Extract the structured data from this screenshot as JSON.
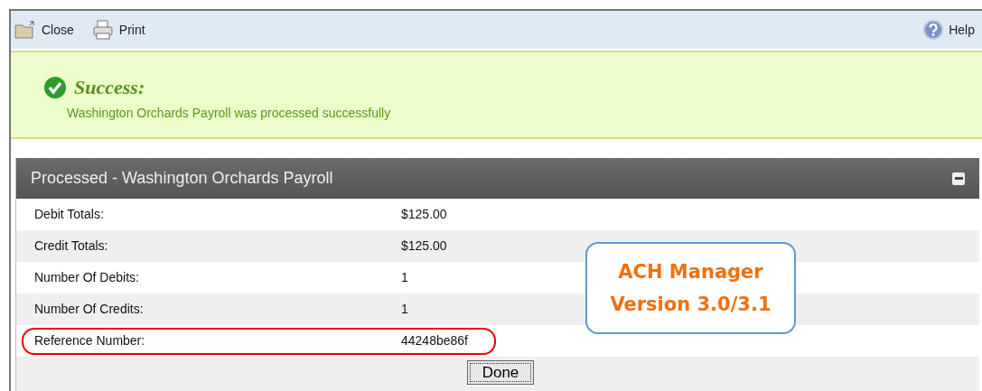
{
  "toolbar": {
    "left": [
      {
        "kind": "close",
        "label": "Close"
      },
      {
        "kind": "print",
        "label": "Print"
      }
    ],
    "right": {
      "kind": "help",
      "label": "Help"
    }
  },
  "message": {
    "title": "Success:",
    "text": "Washington Orchards Payroll was processed successfully"
  },
  "panel": {
    "title": "Processed - Washington Orchards Payroll",
    "rows": [
      {
        "label": "Debit Totals:",
        "value": "$125.00",
        "highlighted": false
      },
      {
        "label": "Credit Totals:",
        "value": "$125.00",
        "highlighted": false
      },
      {
        "label": "Number Of Debits:",
        "value": "1",
        "highlighted": false
      },
      {
        "label": "Number Of Credits:",
        "value": "1",
        "highlighted": false
      },
      {
        "label": "Reference Number:",
        "value": "44248be86f",
        "highlighted": true
      }
    ],
    "button": "Done"
  },
  "callout": {
    "lines": [
      "ACH Manager",
      "Version 3.0/3.1"
    ]
  }
}
